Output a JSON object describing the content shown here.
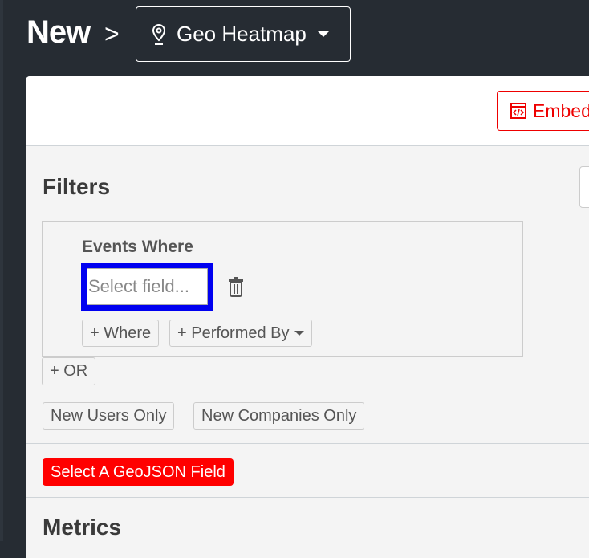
{
  "breadcrumb": {
    "root": "New",
    "separator": ">",
    "chart_type": "Geo Heatmap"
  },
  "header": {
    "embed_label": "Embed"
  },
  "filters": {
    "title": "Filters",
    "group_label": "Events Where",
    "field_placeholder": "Select field...",
    "where_label": "+ Where",
    "performed_by_label": "+ Performed By",
    "or_label": "+ OR",
    "new_users_label": "New Users Only",
    "new_companies_label": "New Companies Only"
  },
  "geojson_warning": "Select A GeoJSON Field",
  "metrics": {
    "title": "Metrics"
  },
  "colors": {
    "background": "#262c33",
    "accent": "#ff0000",
    "focus": "#0000f0"
  }
}
